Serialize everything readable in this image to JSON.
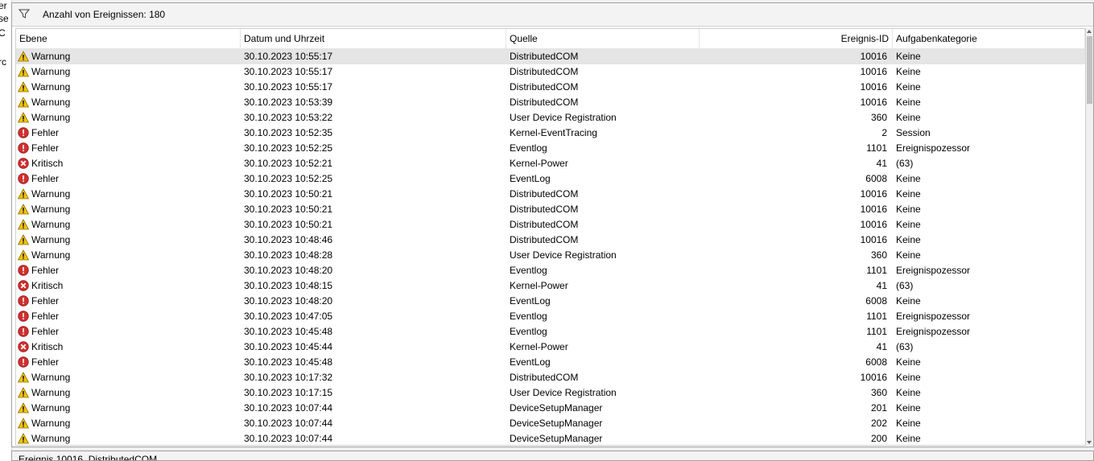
{
  "left_sliver": [
    "er",
    "se",
    "C",
    "rc"
  ],
  "filterbar": {
    "count_label": "Anzahl von Ereignissen: 180",
    "icon": "filter-icon"
  },
  "columns": [
    "Ebene",
    "Datum und Uhrzeit",
    "Quelle",
    "",
    "Ereignis-ID",
    "Aufgabenkategorie"
  ],
  "level_icons": {
    "Warnung": "warning-icon",
    "Fehler": "error-icon",
    "Kritisch": "critical-icon"
  },
  "rows": [
    {
      "level": "Warnung",
      "date": "30.10.2023 10:55:17",
      "source": "DistributedCOM",
      "id": "10016",
      "category": "Keine"
    },
    {
      "level": "Warnung",
      "date": "30.10.2023 10:55:17",
      "source": "DistributedCOM",
      "id": "10016",
      "category": "Keine"
    },
    {
      "level": "Warnung",
      "date": "30.10.2023 10:55:17",
      "source": "DistributedCOM",
      "id": "10016",
      "category": "Keine"
    },
    {
      "level": "Warnung",
      "date": "30.10.2023 10:53:39",
      "source": "DistributedCOM",
      "id": "10016",
      "category": "Keine"
    },
    {
      "level": "Warnung",
      "date": "30.10.2023 10:53:22",
      "source": "User Device Registration",
      "id": "360",
      "category": "Keine"
    },
    {
      "level": "Fehler",
      "date": "30.10.2023 10:52:35",
      "source": "Kernel-EventTracing",
      "id": "2",
      "category": "Session"
    },
    {
      "level": "Fehler",
      "date": "30.10.2023 10:52:25",
      "source": "Eventlog",
      "id": "1101",
      "category": "Ereignispozessor"
    },
    {
      "level": "Kritisch",
      "date": "30.10.2023 10:52:21",
      "source": "Kernel-Power",
      "id": "41",
      "category": "(63)"
    },
    {
      "level": "Fehler",
      "date": "30.10.2023 10:52:25",
      "source": "EventLog",
      "id": "6008",
      "category": "Keine"
    },
    {
      "level": "Warnung",
      "date": "30.10.2023 10:50:21",
      "source": "DistributedCOM",
      "id": "10016",
      "category": "Keine"
    },
    {
      "level": "Warnung",
      "date": "30.10.2023 10:50:21",
      "source": "DistributedCOM",
      "id": "10016",
      "category": "Keine"
    },
    {
      "level": "Warnung",
      "date": "30.10.2023 10:50:21",
      "source": "DistributedCOM",
      "id": "10016",
      "category": "Keine"
    },
    {
      "level": "Warnung",
      "date": "30.10.2023 10:48:46",
      "source": "DistributedCOM",
      "id": "10016",
      "category": "Keine"
    },
    {
      "level": "Warnung",
      "date": "30.10.2023 10:48:28",
      "source": "User Device Registration",
      "id": "360",
      "category": "Keine"
    },
    {
      "level": "Fehler",
      "date": "30.10.2023 10:48:20",
      "source": "Eventlog",
      "id": "1101",
      "category": "Ereignispozessor"
    },
    {
      "level": "Kritisch",
      "date": "30.10.2023 10:48:15",
      "source": "Kernel-Power",
      "id": "41",
      "category": "(63)"
    },
    {
      "level": "Fehler",
      "date": "30.10.2023 10:48:20",
      "source": "EventLog",
      "id": "6008",
      "category": "Keine"
    },
    {
      "level": "Fehler",
      "date": "30.10.2023 10:47:05",
      "source": "Eventlog",
      "id": "1101",
      "category": "Ereignispozessor"
    },
    {
      "level": "Fehler",
      "date": "30.10.2023 10:45:48",
      "source": "Eventlog",
      "id": "1101",
      "category": "Ereignispozessor"
    },
    {
      "level": "Kritisch",
      "date": "30.10.2023 10:45:44",
      "source": "Kernel-Power",
      "id": "41",
      "category": "(63)"
    },
    {
      "level": "Fehler",
      "date": "30.10.2023 10:45:48",
      "source": "EventLog",
      "id": "6008",
      "category": "Keine"
    },
    {
      "level": "Warnung",
      "date": "30.10.2023 10:17:32",
      "source": "DistributedCOM",
      "id": "10016",
      "category": "Keine"
    },
    {
      "level": "Warnung",
      "date": "30.10.2023 10:17:15",
      "source": "User Device Registration",
      "id": "360",
      "category": "Keine"
    },
    {
      "level": "Warnung",
      "date": "30.10.2023 10:07:44",
      "source": "DeviceSetupManager",
      "id": "201",
      "category": "Keine"
    },
    {
      "level": "Warnung",
      "date": "30.10.2023 10:07:44",
      "source": "DeviceSetupManager",
      "id": "202",
      "category": "Keine"
    },
    {
      "level": "Warnung",
      "date": "30.10.2023 10:07:44",
      "source": "DeviceSetupManager",
      "id": "200",
      "category": "Keine"
    }
  ],
  "bottom_panel": {
    "title": "Ereignis 10016, DistributedCOM"
  },
  "colors": {
    "warning": "#f5c400",
    "error": "#d32f2f",
    "critical": "#d32f2f",
    "selected_row": "#e5e5e5"
  }
}
